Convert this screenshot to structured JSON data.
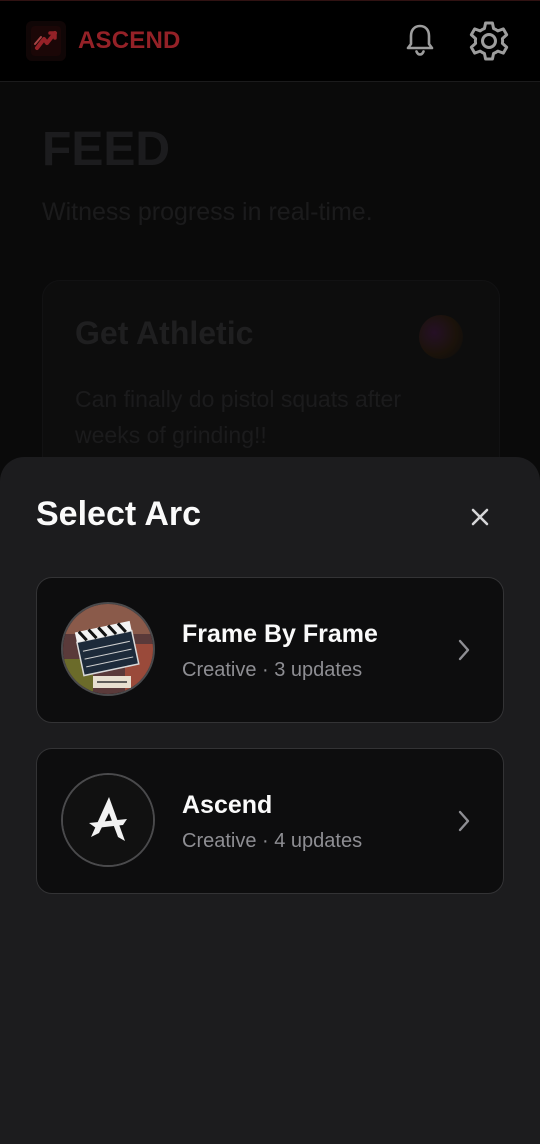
{
  "app": {
    "name": "ASCEND",
    "brand_color": "#e3343c"
  },
  "header": {
    "notifications_icon": "bell-icon",
    "settings_icon": "gear-icon"
  },
  "feed": {
    "title": "FEED",
    "subtitle": "Witness progress in real-time.",
    "post": {
      "title": "Get Athletic",
      "body": "Can finally do pistol squats after weeks of grinding!!"
    }
  },
  "sheet": {
    "title": "Select Arc",
    "close_icon": "close-icon",
    "arcs": [
      {
        "name": "Frame By Frame",
        "meta": "Creative · 3 updates",
        "avatar_icon": "clapperboard-image"
      },
      {
        "name": "Ascend",
        "meta": "Creative · 4 updates",
        "avatar_icon": "ascend-logo"
      }
    ]
  }
}
